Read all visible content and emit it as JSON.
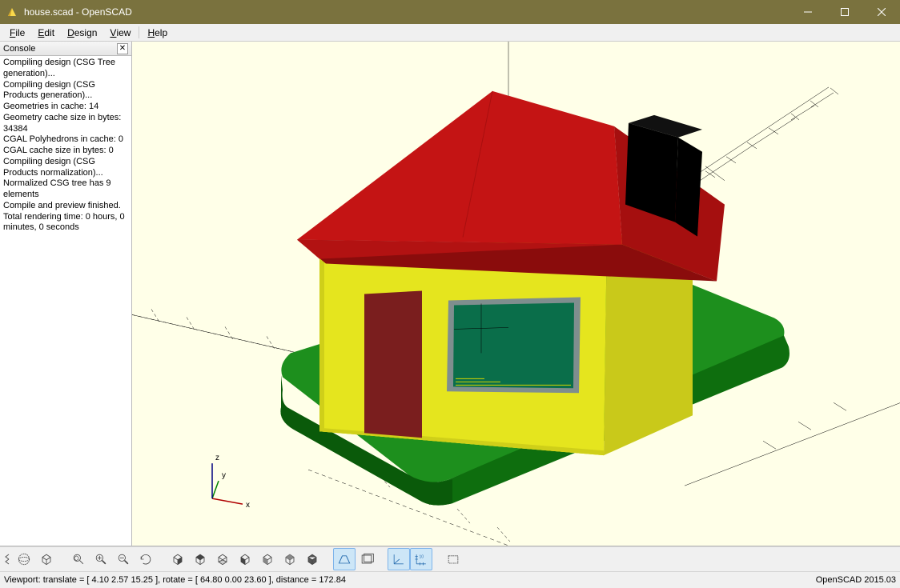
{
  "titlebar": {
    "title": "house.scad - OpenSCAD"
  },
  "menubar": {
    "file": {
      "prefix": "",
      "accel": "F",
      "rest": "ile"
    },
    "edit": {
      "prefix": "",
      "accel": "E",
      "rest": "dit"
    },
    "design": {
      "prefix": "",
      "accel": "D",
      "rest": "esign"
    },
    "view": {
      "prefix": "",
      "accel": "V",
      "rest": "iew"
    },
    "help": {
      "prefix": "",
      "accel": "H",
      "rest": "elp"
    }
  },
  "console": {
    "title": "Console",
    "lines": [
      "Compiling design (CSG Tree generation)...",
      "Compiling design (CSG Products generation)...",
      "Geometries in cache: 14",
      "Geometry cache size in bytes: 34384",
      "CGAL Polyhedrons in cache: 0",
      "CGAL cache size in bytes: 0",
      "Compiling design (CSG Products normalization)...",
      "Normalized CSG tree has 9 elements",
      "Compile and preview finished.",
      "Total rendering time: 0 hours, 0 minutes, 0 seconds"
    ]
  },
  "statusbar": {
    "left": "Viewport: translate = [ 4.10 2.57 15.25 ], rotate = [ 64.80 0.00 23.60 ], distance = 172.84",
    "right": "OpenSCAD 2015.03"
  },
  "toolbar_icons": [
    "preview",
    "render",
    "sep",
    "view-all",
    "zoom-in",
    "zoom-out",
    "reset-view",
    "sep",
    "view-right",
    "view-top",
    "view-bottom",
    "view-left",
    "view-front",
    "view-back",
    "view-diagonal",
    "sep",
    "perspective",
    "orthogonal",
    "sep",
    "axes",
    "scalemarkers",
    "sep",
    "edges"
  ]
}
